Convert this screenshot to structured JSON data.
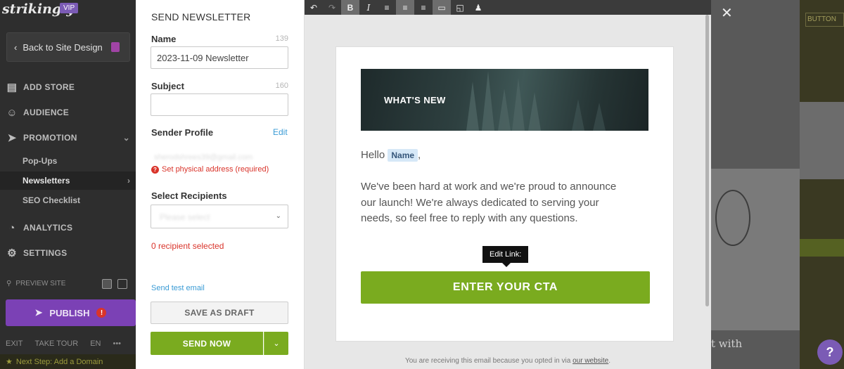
{
  "sidebar": {
    "logo": "strikingly",
    "vip": "VIP",
    "back_label": "Back to Site Design",
    "sections": {
      "add_store": "ADD STORE",
      "audience": "AUDIENCE",
      "promotion": "PROMOTION",
      "analytics": "ANALYTICS",
      "settings": "SETTINGS"
    },
    "promotion_items": {
      "popups": "Pop-Ups",
      "newsletters": "Newsletters",
      "seo": "SEO Checklist"
    },
    "preview_label": "PREVIEW SITE",
    "publish_label": "PUBLISH",
    "publish_warn": "!",
    "exit_label": "EXIT",
    "tour_label": "TAKE TOUR",
    "lang_label": "EN",
    "more_label": "•••",
    "next_step": "Next Step: Add a Domain"
  },
  "form": {
    "title": "SEND NEWSLETTER",
    "name_label": "Name",
    "name_count": "139",
    "name_value": "2023-11-09 Newsletter",
    "subject_label": "Subject",
    "subject_count": "160",
    "subject_value": "",
    "sender_label": "Sender Profile",
    "sender_edit": "Edit",
    "sender_blurred": "sherodshrees39@gmail.com",
    "sender_error": "Set physical address (required)",
    "recipients_label": "Select Recipients",
    "recipients_placeholder": "Please select",
    "recipients_status": "0 recipient selected",
    "test_email": "Send test email",
    "draft_button": "SAVE AS DRAFT",
    "send_button": "SEND NOW"
  },
  "editor": {
    "hero_text": "WHAT'S NEW",
    "greeting_prefix": "Hello",
    "greeting_name": "Name",
    "greeting_suffix": ",",
    "body": "We've been hard at work and we're proud to announce our launch! We're always dedicated to serving your needs, so feel free to reply with any questions.",
    "tooltip": "Edit Link:",
    "cta": "ENTER YOUR CTA",
    "footer_text": "You are receiving this email because you opted in via ",
    "footer_link": "our website",
    "footer_end": "."
  },
  "overlay": {
    "close": "✕",
    "button_text": "BUTTON",
    "bg_text": "t with"
  },
  "help": "?",
  "colors": {
    "accent_green": "#7aab1f",
    "brand_purple": "#7b41b5",
    "error_red": "#d9342b",
    "link_blue": "#3a9bd5"
  }
}
